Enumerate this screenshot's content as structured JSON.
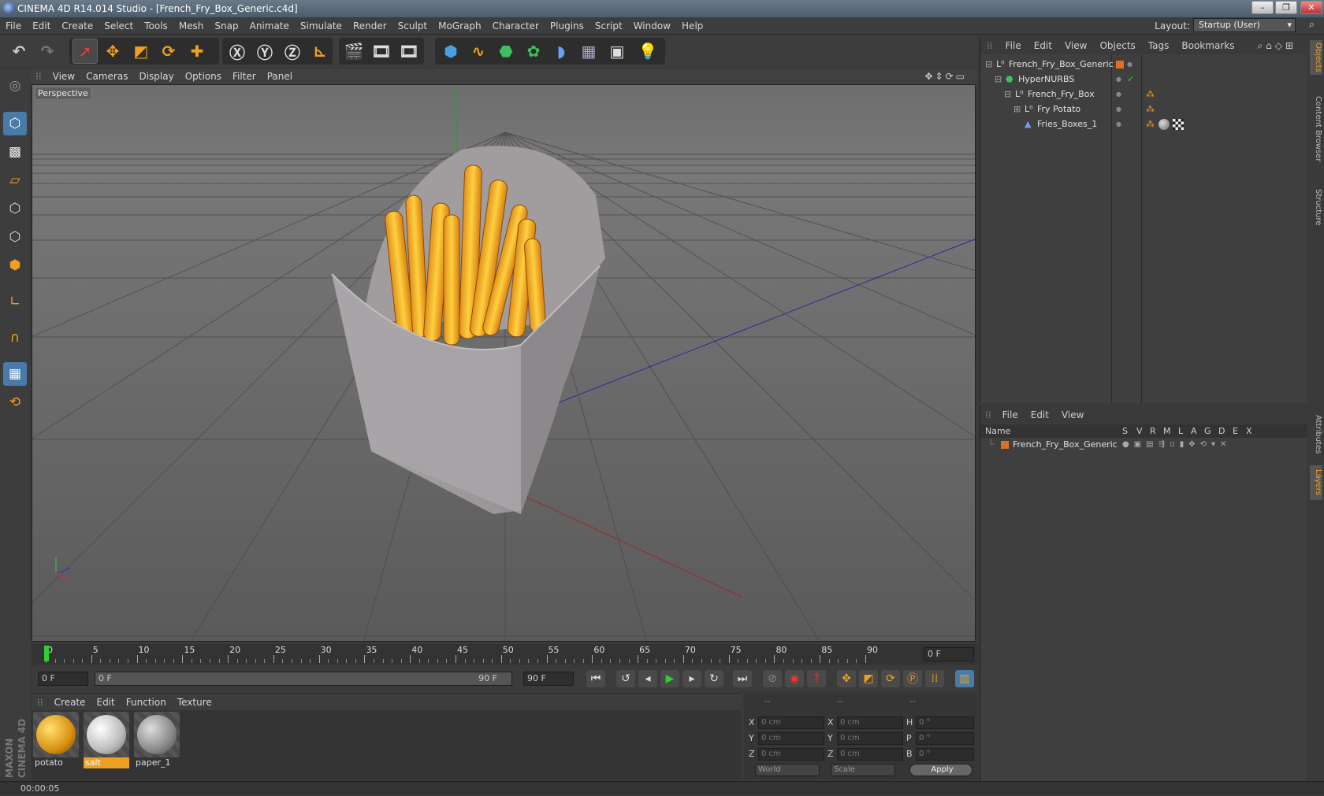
{
  "window": {
    "title": "CINEMA 4D R14.014 Studio - [French_Fry_Box_Generic.c4d]",
    "min": "–",
    "max": "❐",
    "close": "✕"
  },
  "menu": [
    "File",
    "Edit",
    "Create",
    "Select",
    "Tools",
    "Mesh",
    "Snap",
    "Animate",
    "Simulate",
    "Render",
    "Sculpt",
    "MoGraph",
    "Character",
    "Plugins",
    "Script",
    "Window",
    "Help"
  ],
  "layout": {
    "label": "Layout:",
    "value": "Startup (User)"
  },
  "viewport": {
    "menu": [
      "View",
      "Cameras",
      "Display",
      "Options",
      "Filter",
      "Panel"
    ],
    "label": "Perspective"
  },
  "timeline": {
    "ticks": [
      "0",
      "5",
      "10",
      "15",
      "20",
      "25",
      "30",
      "35",
      "40",
      "45",
      "50",
      "55",
      "60",
      "65",
      "70",
      "75",
      "80",
      "85",
      "90"
    ],
    "current_frame": "0 F"
  },
  "transport": {
    "start": "0 F",
    "range_start": "0 F",
    "range_end": "90 F",
    "end": "90 F"
  },
  "materials": {
    "menu": [
      "Create",
      "Edit",
      "Function",
      "Texture"
    ],
    "items": [
      {
        "name": "potato"
      },
      {
        "name": "salt"
      },
      {
        "name": "paper_1"
      }
    ]
  },
  "coords": {
    "headers": [
      "--",
      "--",
      "--"
    ],
    "rows": [
      {
        "a": "X",
        "av": "0 cm",
        "b": "X",
        "bv": "0 cm",
        "c": "H",
        "cv": "0 °"
      },
      {
        "a": "Y",
        "av": "0 cm",
        "b": "Y",
        "bv": "0 cm",
        "c": "P",
        "cv": "0 °"
      },
      {
        "a": "Z",
        "av": "0 cm",
        "b": "Z",
        "bv": "0 cm",
        "c": "B",
        "cv": "0 °"
      }
    ],
    "mode1": "World",
    "mode2": "Scale",
    "apply": "Apply"
  },
  "objects": {
    "menu": [
      "File",
      "Edit",
      "View",
      "Objects",
      "Tags",
      "Bookmarks"
    ],
    "tree": [
      {
        "name": "French_Fry_Box_Generic",
        "indent": 0
      },
      {
        "name": "HyperNURBS",
        "indent": 1
      },
      {
        "name": "French_Fry_Box",
        "indent": 2
      },
      {
        "name": "Fry Potato",
        "indent": 3
      },
      {
        "name": "Fries_Boxes_1",
        "indent": 3
      }
    ]
  },
  "layers": {
    "menu": [
      "File",
      "Edit",
      "View"
    ],
    "columns": [
      "Name",
      "S",
      "V",
      "R",
      "M",
      "L",
      "A",
      "G",
      "D",
      "E",
      "X"
    ],
    "items": [
      {
        "name": "French_Fry_Box_Generic",
        "color": "#e07020"
      }
    ]
  },
  "side_tabs": [
    "Objects",
    "Content Browser",
    "Structure",
    "Attributes",
    "Layers"
  ],
  "status": "00:00:05",
  "brand": "MAXON CINEMA 4D",
  "colors": {
    "accent": "#f0a020",
    "active": "#4a7aa8"
  }
}
